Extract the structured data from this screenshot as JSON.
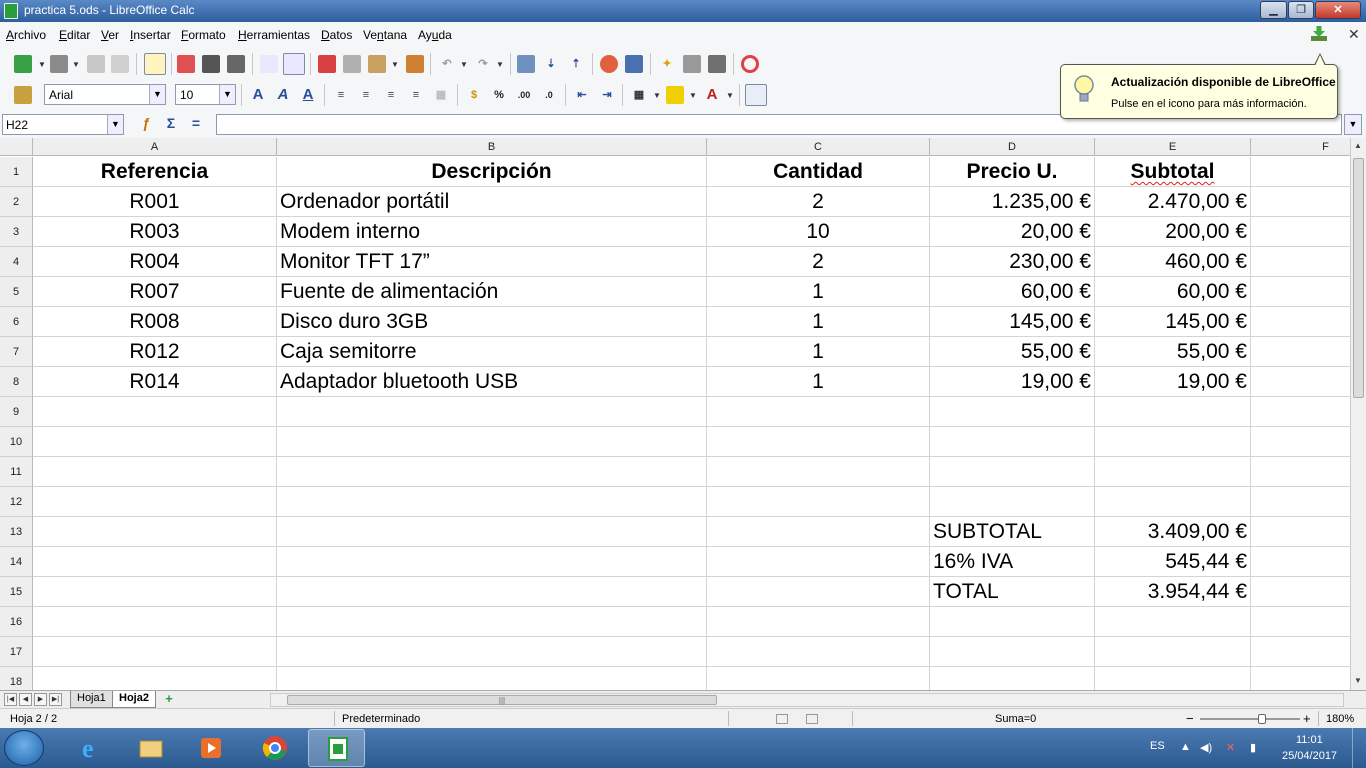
{
  "window": {
    "title": "practica 5.ods - LibreOffice Calc",
    "minimize": "▁",
    "maximize": "❐",
    "close": "✕"
  },
  "menubar": {
    "items": [
      {
        "pre": "",
        "u": "A",
        "post": "rchivo"
      },
      {
        "pre": "",
        "u": "E",
        "post": "ditar"
      },
      {
        "pre": "",
        "u": "V",
        "post": "er"
      },
      {
        "pre": "",
        "u": "I",
        "post": "nsertar"
      },
      {
        "pre": "",
        "u": "F",
        "post": "ormato"
      },
      {
        "pre": "",
        "u": "H",
        "post": "erramientas"
      },
      {
        "pre": "",
        "u": "D",
        "post": "atos"
      },
      {
        "pre": "Ve",
        "u": "n",
        "post": "tana"
      },
      {
        "pre": "Ay",
        "u": "u",
        "post": "da"
      }
    ],
    "doc_close": "✕"
  },
  "formatting": {
    "font_name": "Arial",
    "font_size": "10"
  },
  "formula_bar": {
    "name_box": "H22",
    "formula": ""
  },
  "notification": {
    "title": "Actualización disponible de LibreOffice",
    "text": "Pulse en el icono para más información."
  },
  "grid": {
    "columns": [
      "A",
      "B",
      "C",
      "D",
      "E",
      "F"
    ],
    "rows": [
      "1",
      "2",
      "3",
      "4",
      "5",
      "6",
      "7",
      "8",
      "9",
      "10",
      "11",
      "12",
      "13",
      "14",
      "15",
      "16",
      "17",
      "18"
    ],
    "header": {
      "referencia": "Referencia",
      "descripcion": "Descripción",
      "cantidad": "Cantidad",
      "precio": "Precio U.",
      "subtotal": "Subtotal"
    },
    "items": [
      {
        "ref": "R001",
        "desc": "Ordenador portátil",
        "qty": "2",
        "price": "1.235,00 €",
        "subtotal": "2.470,00 €"
      },
      {
        "ref": "R003",
        "desc": "Modem interno",
        "qty": "10",
        "price": "20,00 €",
        "subtotal": "200,00 €"
      },
      {
        "ref": "R004",
        "desc": "Monitor TFT 17”",
        "qty": "2",
        "price": "230,00 €",
        "subtotal": "460,00 €"
      },
      {
        "ref": "R007",
        "desc": "Fuente de alimentación",
        "qty": "1",
        "price": "60,00 €",
        "subtotal": "60,00 €"
      },
      {
        "ref": "R008",
        "desc": "Disco duro 3GB",
        "qty": "1",
        "price": "145,00 €",
        "subtotal": "145,00 €"
      },
      {
        "ref": "R012",
        "desc": "Caja semitorre",
        "qty": "1",
        "price": "55,00 €",
        "subtotal": "55,00 €"
      },
      {
        "ref": "R014",
        "desc": "Adaptador bluetooth USB",
        "qty": "1",
        "price": "19,00 €",
        "subtotal": "19,00 €"
      }
    ],
    "totals": [
      {
        "label": "SUBTOTAL",
        "value": "3.409,00 €"
      },
      {
        "label": "16% IVA",
        "value": "545,44 €"
      },
      {
        "label": "TOTAL",
        "value": "3.954,44 €"
      }
    ]
  },
  "sheets": {
    "tabs": [
      "Hoja1",
      "Hoja2"
    ],
    "active": "Hoja2",
    "add": "+"
  },
  "statusbar": {
    "sheet_info": "Hoja 2 / 2",
    "page_style": "Predeterminado",
    "sum": "Suma=0",
    "zoom_minus": "−",
    "zoom_plus": "+",
    "zoom": "180%"
  },
  "taskbar": {
    "language": "ES",
    "time": "11:01",
    "date": "25/04/2017"
  },
  "colors": {
    "title_bar": "#2c5d9e",
    "calc_green": "#2a9d3c",
    "notification_bg": "#ffffe1",
    "spell_underline": "#e02020"
  }
}
